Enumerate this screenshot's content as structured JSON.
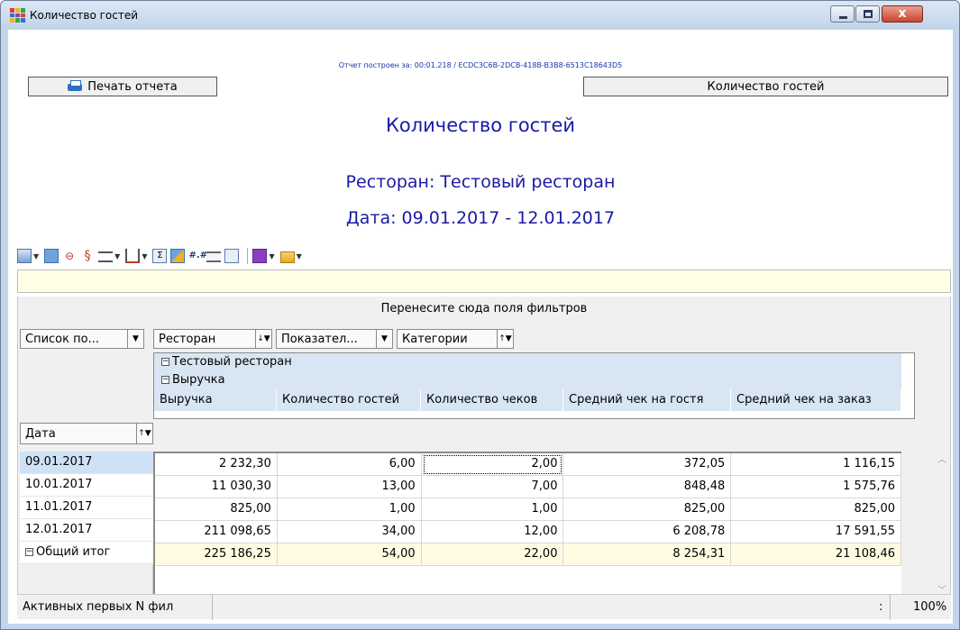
{
  "window": {
    "title": "Количество гостей",
    "buttons": {
      "minimize": "minimize",
      "maximize": "maximize",
      "close": "x"
    }
  },
  "report": {
    "build_info": "Отчет построен за: 00:01.218 / ECDC3C6B-2DCB-418B-B3B8-6513C18643D5",
    "print_button": "Печать отчета",
    "name_button": "Количество гостей",
    "title": "Количество гостей",
    "restaurant_line": "Ресторан: Тестовый ресторан",
    "date_line": "Дата: 09.01.2017 - 12.01.2017"
  },
  "toolbar": {
    "icons": [
      "export-icon",
      "layout-icon",
      "chain-icon",
      "split-icon",
      "rows-align-icon",
      "columns-align-icon",
      "sum-icon",
      "chart-icon",
      "number-format-icon",
      "list-icon",
      "info-icon",
      "save-icon",
      "open-folder-icon"
    ]
  },
  "pivot": {
    "drop_hint": "Перенесите сюда поля фильтров",
    "fields": {
      "data_list": "Список по...",
      "restaurant": "Ресторан",
      "indicators": "Показател...",
      "categories": "Категории",
      "date": "Дата"
    },
    "sort_up": "↑▼",
    "sort_down": "↓▼",
    "dropdown": "▼",
    "column_group": "Тестовый ресторан",
    "column_subgroup": "Выручка",
    "expand_minus": "−",
    "columns": [
      "Выручка",
      "Количество гостей",
      "Количество чеков",
      "Средний чек на гостя",
      "Средний чек на заказ"
    ],
    "rows": [
      {
        "label": "09.01.2017",
        "values": [
          "2 232,30",
          "6,00",
          "2,00",
          "372,05",
          "1 116,15"
        ]
      },
      {
        "label": "10.01.2017",
        "values": [
          "11 030,30",
          "13,00",
          "7,00",
          "848,48",
          "1 575,76"
        ]
      },
      {
        "label": "11.01.2017",
        "values": [
          "825,00",
          "1,00",
          "1,00",
          "825,00",
          "825,00"
        ]
      },
      {
        "label": "12.01.2017",
        "values": [
          "211 098,65",
          "34,00",
          "12,00",
          "6 208,78",
          "17 591,55"
        ]
      }
    ],
    "total": {
      "label": "Общий итог",
      "values": [
        "225 186,25",
        "54,00",
        "22,00",
        "8 254,31",
        "21 108,46"
      ]
    }
  },
  "statusbar": {
    "left": "Активных первых N фил",
    "colon": ":",
    "zoom": "100%"
  },
  "colors": {
    "title_blue": "#1a1aa6",
    "header_blue": "#d8e6f4",
    "total_row": "#fffbe3",
    "filter_bar": "#ffffe6"
  }
}
